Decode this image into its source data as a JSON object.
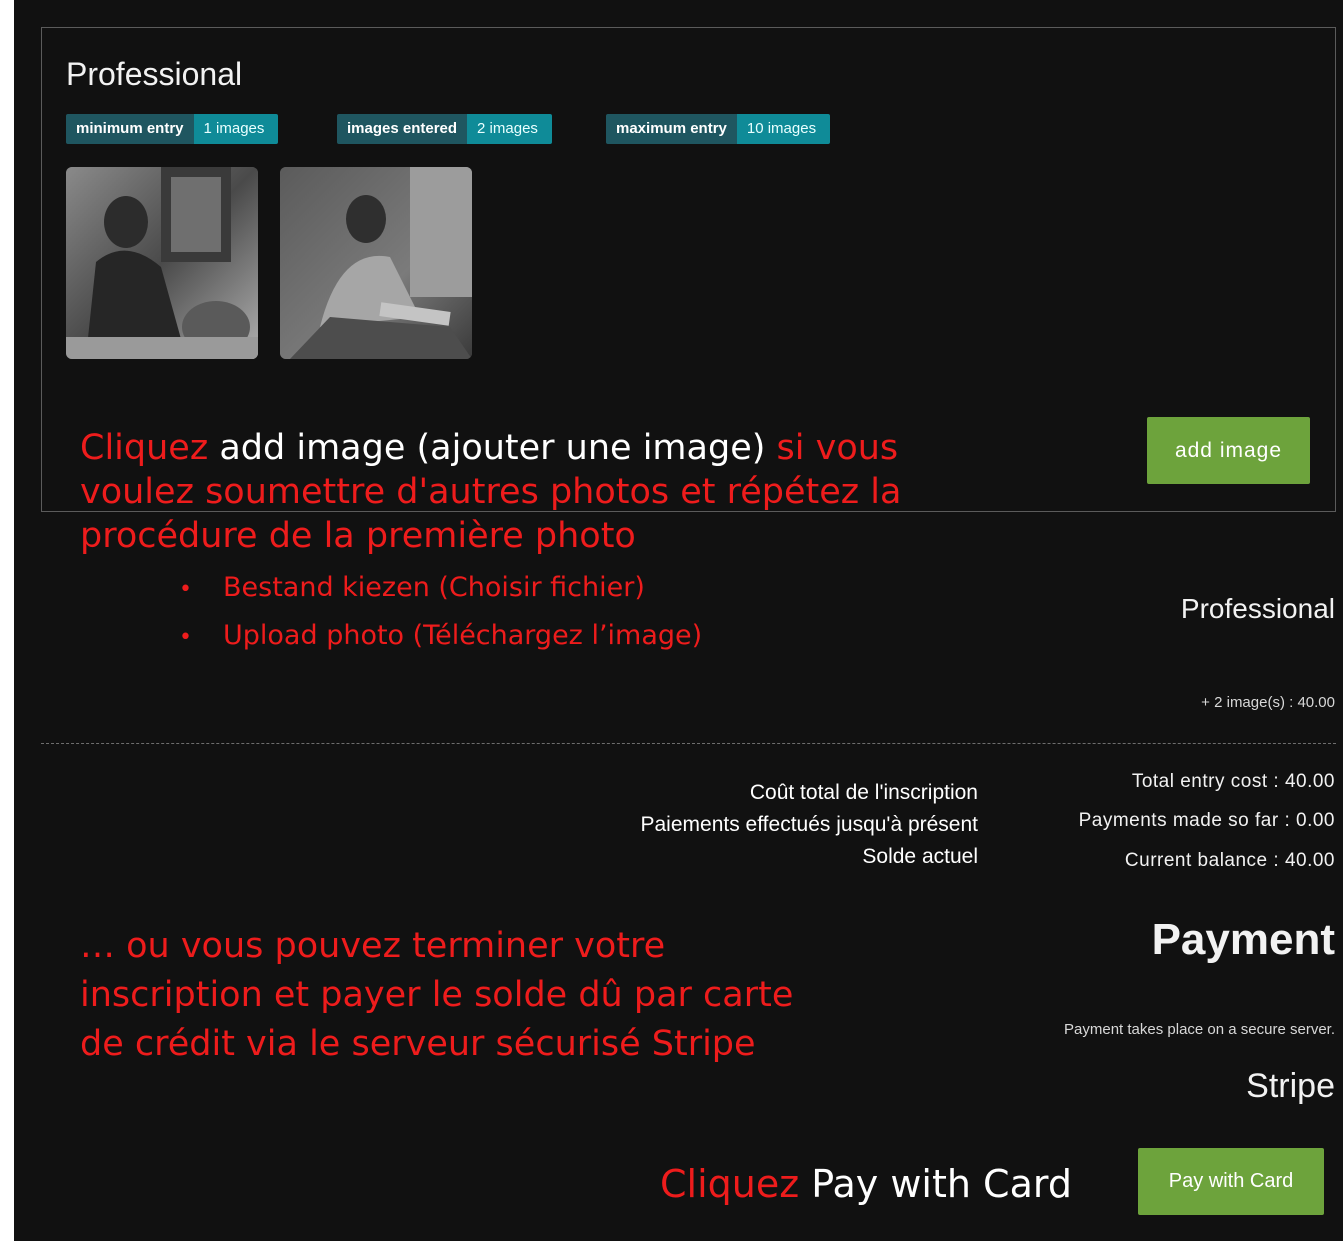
{
  "entry": {
    "category_title": "Professional",
    "badges": [
      {
        "label": "minimum entry",
        "value": "1 images"
      },
      {
        "label": "images entered",
        "value": "2 images"
      },
      {
        "label": "maximum entry",
        "value": "10 images"
      }
    ],
    "thumbnails": [
      "photo-thumbnail",
      "photo-thumbnail"
    ],
    "add_image_label": "add image"
  },
  "instructions": {
    "add_click": "Cliquez",
    "add_target": "add image (ajouter une image)",
    "add_rest_1": "si vous",
    "add_line2": "voulez soumettre d'autres photos et répétez la",
    "add_line3": "procédure de la première photo",
    "bullets": [
      "Bestand kiezen (Choisir fichier)",
      "Upload photo (Téléchargez l’image)"
    ],
    "pay_line1": "… ou vous pouvez terminer votre",
    "pay_line2": "inscription et payer le solde dû par carte",
    "pay_line3": "de crédit via le serveur sécurisé Stripe",
    "click_pay_click": "Cliquez",
    "click_pay_target": "Pay with Card"
  },
  "summary": {
    "category": "Professional",
    "line_item": "+ 2 image(s) : 40.00",
    "fr_labels": [
      "Coût total de l'inscription",
      "Paiements effectués jusqu'à présent",
      "Solde actuel"
    ],
    "en_lines": [
      "Total entry cost : 40.00",
      "Payments made so far : 0.00",
      "Current balance : 40.00"
    ]
  },
  "payment": {
    "title": "Payment",
    "secure_note": "Payment takes place on a secure server.",
    "provider": "Stripe",
    "pay_button": "Pay with Card"
  },
  "colors": {
    "background": "#111111",
    "accent_green": "#6da33c",
    "badge_label": "#1f5660",
    "badge_value": "#0f8b98",
    "annotation_red": "#ee1c1c"
  }
}
